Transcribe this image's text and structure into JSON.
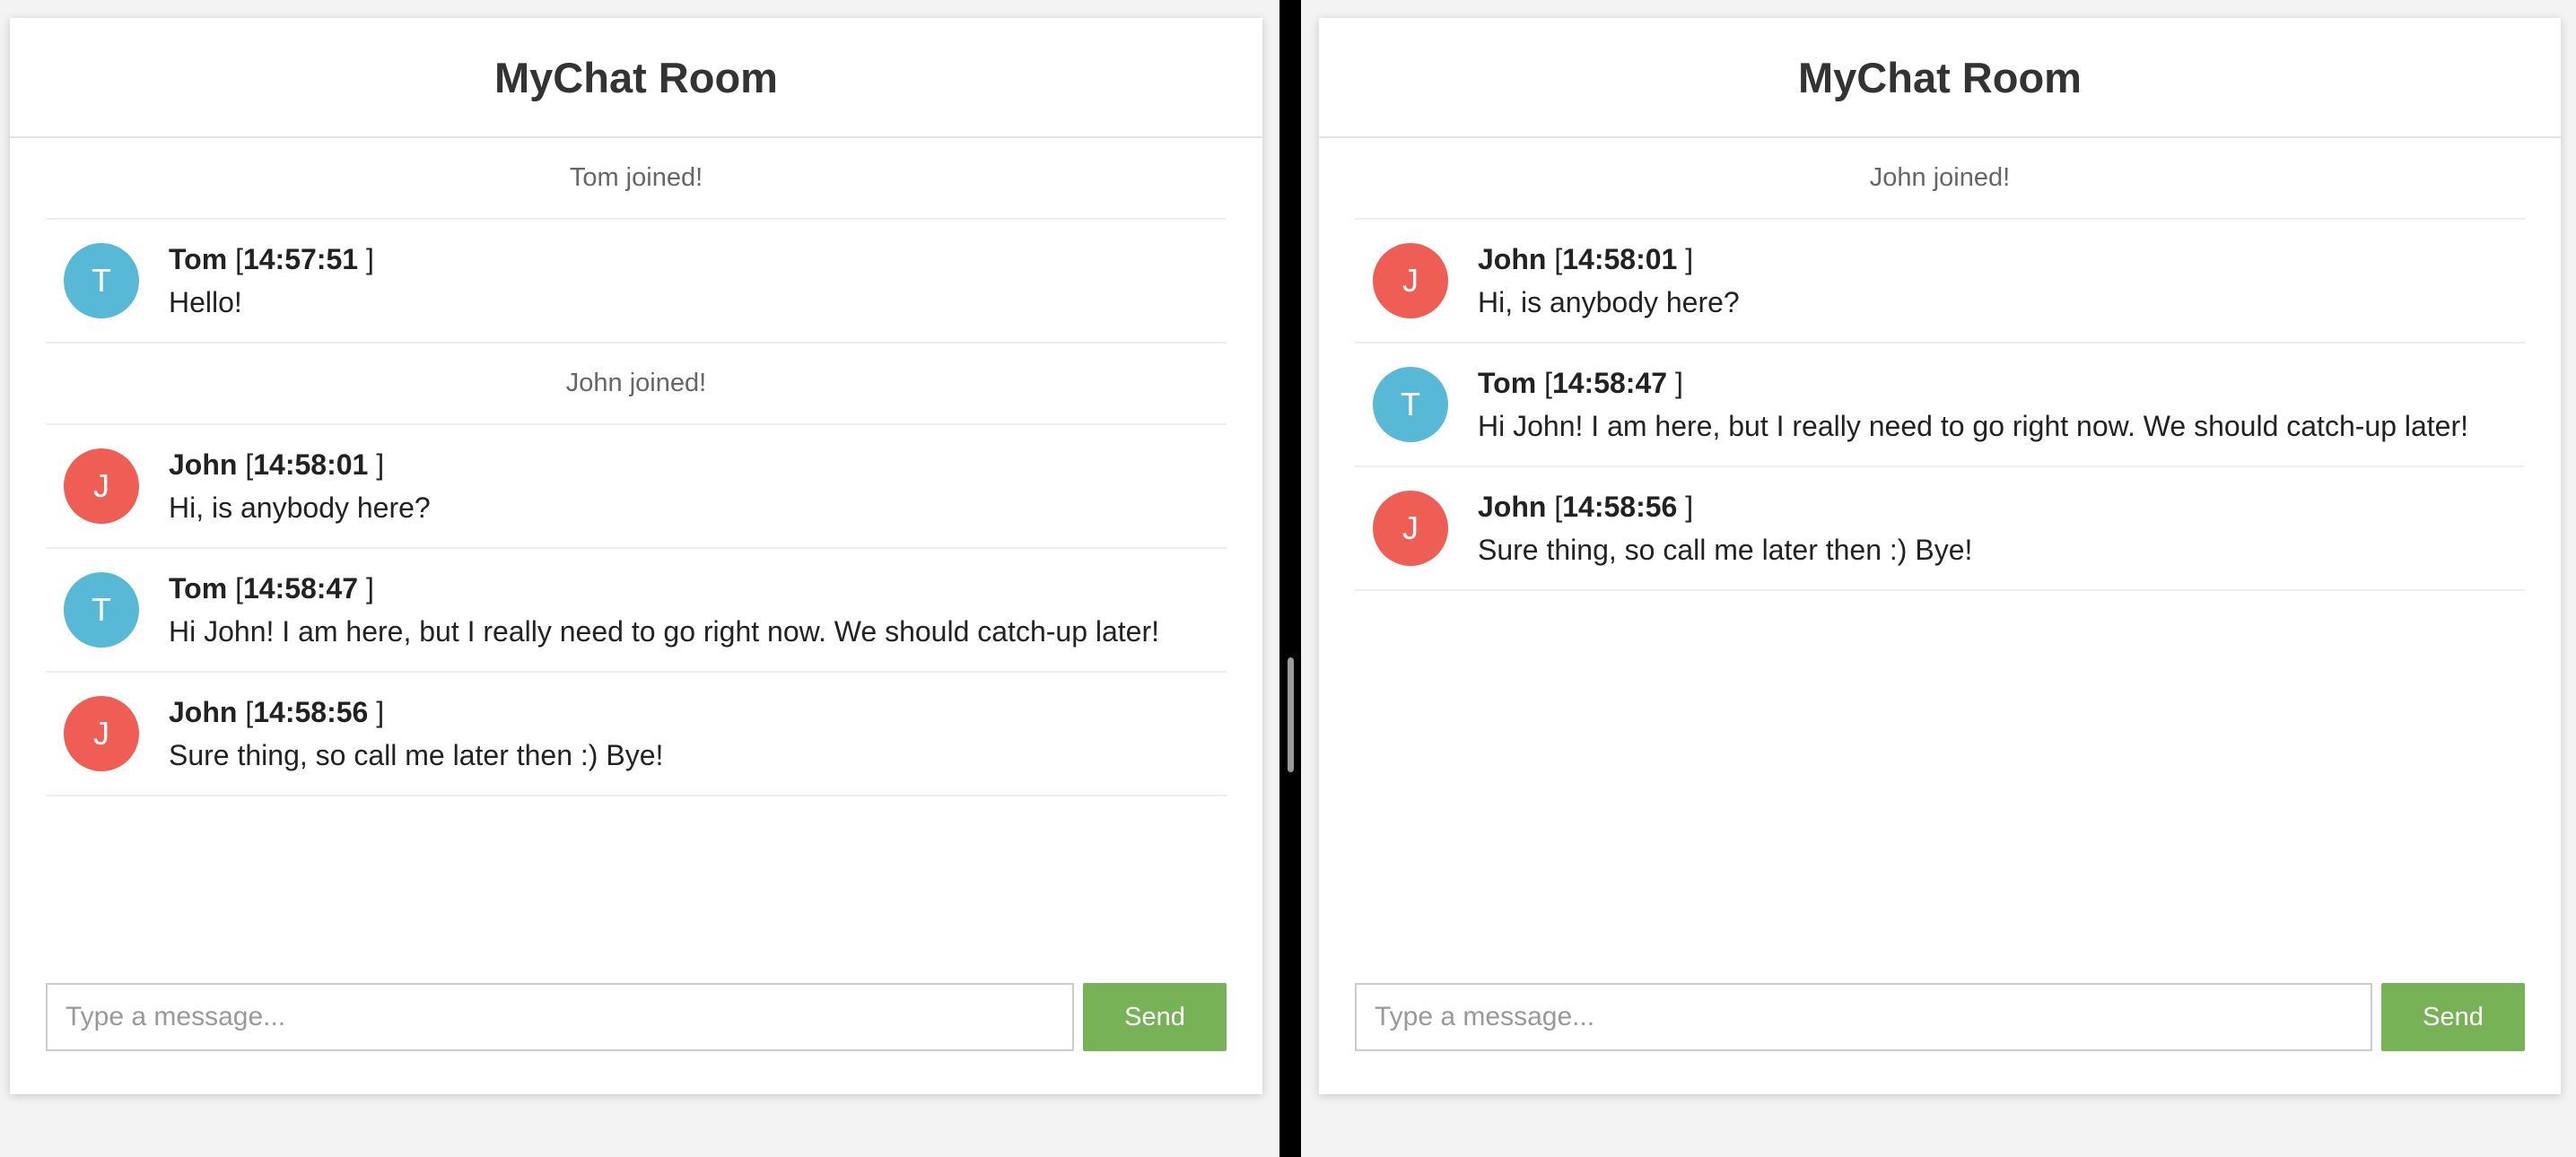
{
  "colors": {
    "avatar_tom": "#58b9d6",
    "avatar_john": "#ee5e55",
    "send_button": "#77b257"
  },
  "left_chat": {
    "title": "MyChat Room",
    "placeholder": "Type a message...",
    "send_label": "Send",
    "items": [
      {
        "kind": "system",
        "text": "Tom joined!"
      },
      {
        "kind": "message",
        "avatar": "T",
        "author": "Tom",
        "time_open": "[",
        "time": "14:57:51",
        "time_close": "]",
        "text": "Hello!"
      },
      {
        "kind": "system",
        "text": "John joined!"
      },
      {
        "kind": "message",
        "avatar": "J",
        "author": "John",
        "time_open": "[",
        "time": "14:58:01",
        "time_close": "]",
        "text": "Hi, is anybody here?"
      },
      {
        "kind": "message",
        "avatar": "T",
        "author": "Tom",
        "time_open": "[",
        "time": "14:58:47",
        "time_close": "]",
        "text": "Hi John! I am here, but I really need to go right now. We should catch-up later!"
      },
      {
        "kind": "message",
        "avatar": "J",
        "author": "John",
        "time_open": "[",
        "time": "14:58:56",
        "time_close": "]",
        "text": "Sure thing, so call me later then :) Bye!"
      }
    ]
  },
  "right_chat": {
    "title": "MyChat Room",
    "placeholder": "Type a message...",
    "send_label": "Send",
    "items": [
      {
        "kind": "system",
        "text": "John joined!"
      },
      {
        "kind": "message",
        "avatar": "J",
        "author": "John",
        "time_open": "[",
        "time": "14:58:01",
        "time_close": "]",
        "text": "Hi, is anybody here?"
      },
      {
        "kind": "message",
        "avatar": "T",
        "author": "Tom",
        "time_open": "[",
        "time": "14:58:47",
        "time_close": "]",
        "text": "Hi John! I am here, but I really need to go right now. We should catch-up later!"
      },
      {
        "kind": "message",
        "avatar": "J",
        "author": "John",
        "time_open": "[",
        "time": "14:58:56",
        "time_close": "]",
        "text": "Sure thing, so call me later then :) Bye!"
      }
    ]
  }
}
